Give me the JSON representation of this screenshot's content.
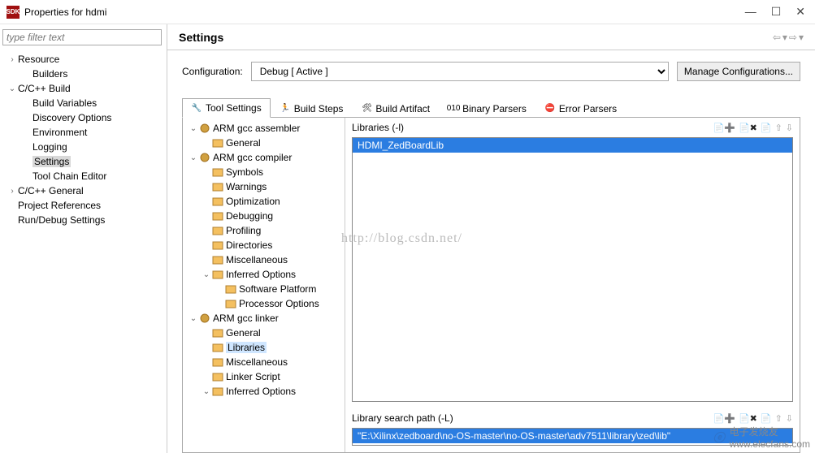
{
  "window": {
    "icon_text": "SDK",
    "title": "Properties for hdmi",
    "min": "—",
    "max": "☐",
    "close": "✕"
  },
  "filter_placeholder": "type filter text",
  "left_tree": [
    {
      "label": "Resource",
      "indent": 0,
      "twist": "›"
    },
    {
      "label": "Builders",
      "indent": 1,
      "twist": ""
    },
    {
      "label": "C/C++ Build",
      "indent": 0,
      "twist": "⌄"
    },
    {
      "label": "Build Variables",
      "indent": 1,
      "twist": ""
    },
    {
      "label": "Discovery Options",
      "indent": 1,
      "twist": ""
    },
    {
      "label": "Environment",
      "indent": 1,
      "twist": ""
    },
    {
      "label": "Logging",
      "indent": 1,
      "twist": ""
    },
    {
      "label": "Settings",
      "indent": 1,
      "twist": "",
      "sel": true
    },
    {
      "label": "Tool Chain Editor",
      "indent": 1,
      "twist": ""
    },
    {
      "label": "C/C++ General",
      "indent": 0,
      "twist": "›"
    },
    {
      "label": "Project References",
      "indent": 0,
      "twist": ""
    },
    {
      "label": "Run/Debug Settings",
      "indent": 0,
      "twist": ""
    }
  ],
  "header": {
    "title": "Settings"
  },
  "config": {
    "label": "Configuration:",
    "value": "Debug  [ Active ]",
    "manage": "Manage Configurations..."
  },
  "tabs": [
    {
      "id": "tool",
      "label": "Tool Settings",
      "icon": "wrench",
      "active": true
    },
    {
      "id": "steps",
      "label": "Build Steps",
      "icon": "steps"
    },
    {
      "id": "artifact",
      "label": "Build Artifact",
      "icon": "artifact"
    },
    {
      "id": "parsers",
      "label": "Binary Parsers",
      "icon": "binary"
    },
    {
      "id": "errors",
      "label": "Error Parsers",
      "icon": "error"
    }
  ],
  "tool_tree": [
    {
      "label": "ARM gcc assembler",
      "indent": 0,
      "twist": "⌄",
      "icon": "tool"
    },
    {
      "label": "General",
      "indent": 1,
      "twist": "",
      "icon": "folder"
    },
    {
      "label": "ARM gcc compiler",
      "indent": 0,
      "twist": "⌄",
      "icon": "tool"
    },
    {
      "label": "Symbols",
      "indent": 1,
      "twist": "",
      "icon": "folder"
    },
    {
      "label": "Warnings",
      "indent": 1,
      "twist": "",
      "icon": "folder"
    },
    {
      "label": "Optimization",
      "indent": 1,
      "twist": "",
      "icon": "folder"
    },
    {
      "label": "Debugging",
      "indent": 1,
      "twist": "",
      "icon": "folder"
    },
    {
      "label": "Profiling",
      "indent": 1,
      "twist": "",
      "icon": "folder"
    },
    {
      "label": "Directories",
      "indent": 1,
      "twist": "",
      "icon": "folder"
    },
    {
      "label": "Miscellaneous",
      "indent": 1,
      "twist": "",
      "icon": "folder"
    },
    {
      "label": "Inferred Options",
      "indent": 1,
      "twist": "⌄",
      "icon": "folder"
    },
    {
      "label": "Software Platform",
      "indent": 2,
      "twist": "",
      "icon": "folder"
    },
    {
      "label": "Processor Options",
      "indent": 2,
      "twist": "",
      "icon": "folder"
    },
    {
      "label": "ARM gcc linker",
      "indent": 0,
      "twist": "⌄",
      "icon": "tool"
    },
    {
      "label": "General",
      "indent": 1,
      "twist": "",
      "icon": "folder"
    },
    {
      "label": "Libraries",
      "indent": 1,
      "twist": "",
      "icon": "folder",
      "sel": true
    },
    {
      "label": "Miscellaneous",
      "indent": 1,
      "twist": "",
      "icon": "folder"
    },
    {
      "label": "Linker Script",
      "indent": 1,
      "twist": "",
      "icon": "folder"
    },
    {
      "label": "Inferred Options",
      "indent": 1,
      "twist": "⌄",
      "icon": "folder"
    }
  ],
  "panels": {
    "libs": {
      "title": "Libraries (-l)",
      "items": [
        "HDMI_ZedBoardLib"
      ]
    },
    "paths": {
      "title": "Library search path (-L)",
      "items": [
        "\"E:\\Xilinx\\zedboard\\no-OS-master\\no-OS-master\\adv7511\\library\\zed\\lib\""
      ]
    }
  },
  "watermark": "http://blog.csdn.net/",
  "footer": {
    "brand": "电子发烧友",
    "url": "www.elecfans.com"
  }
}
